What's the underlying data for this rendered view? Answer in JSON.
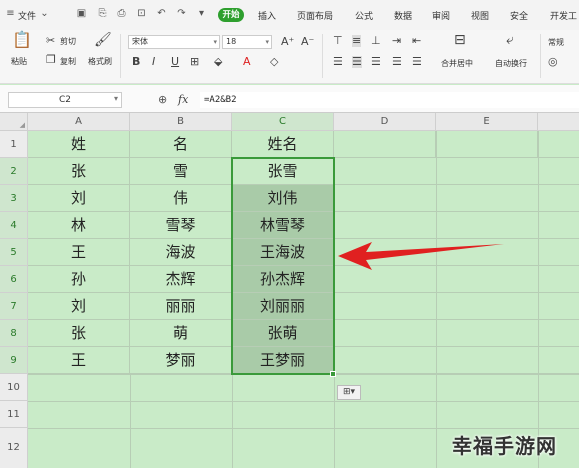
{
  "menubar": {
    "menu_items": [
      "文件",
      "开始",
      "插入",
      "页面布局",
      "公式",
      "数据",
      "审阅",
      "视图",
      "安全",
      "开发工"
    ]
  },
  "ribbon": {
    "paste_label": "粘贴",
    "cut_label": "剪切",
    "copy_label": "复制",
    "format_painter_label": "格式刷",
    "font_name": "宋体",
    "font_size": "18",
    "merge_center_label": "合并居中",
    "wrap_label": "自动换行",
    "number_format": "常规"
  },
  "formula_bar": {
    "cell_ref": "C2",
    "fx_label": "fx",
    "formula": "=A2&B2"
  },
  "sheet": {
    "columns": [
      "A",
      "B",
      "C",
      "D",
      "E"
    ],
    "rows": [
      "1",
      "2",
      "3",
      "4",
      "5",
      "6",
      "7",
      "8",
      "9",
      "10",
      "11",
      "12"
    ],
    "headers": [
      "姓",
      "名",
      "姓名"
    ],
    "data": [
      [
        "张",
        "雪",
        "张雪"
      ],
      [
        "刘",
        "伟",
        "刘伟"
      ],
      [
        "林",
        "雪琴",
        "林雪琴"
      ],
      [
        "王",
        "海波",
        "王海波"
      ],
      [
        "孙",
        "杰辉",
        "孙杰辉"
      ],
      [
        "刘",
        "丽丽",
        "刘丽丽"
      ],
      [
        "张",
        "萌",
        "张萌"
      ],
      [
        "王",
        "梦丽",
        "王梦丽"
      ]
    ]
  },
  "watermark": "幸福手游网",
  "colors": {
    "sheet_bg": "#c9ebc8",
    "selection": "#a9cba8",
    "selection_border": "#3a9a3a",
    "arrow": "#e02020",
    "start_tab": "#2e9f2e"
  }
}
